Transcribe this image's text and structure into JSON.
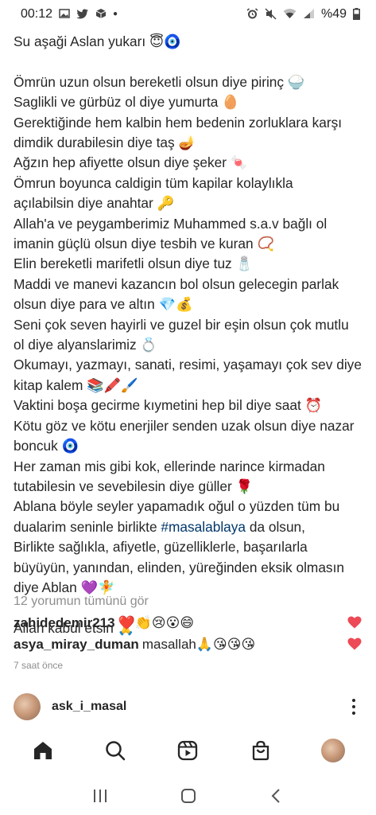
{
  "status_bar": {
    "time": "00:12",
    "battery": "%49",
    "left_icons": [
      "gallery-icon",
      "twitter-icon",
      "box-icon",
      "dot-icon"
    ],
    "right_icons": [
      "alarm-icon",
      "mute-icon",
      "wifi-icon",
      "signal-icon"
    ]
  },
  "caption": {
    "lines": [
      "Su aşaği Aslan yukarı 😇🧿",
      "",
      "Ömrün uzun olsun bereketli olsun diye pirinç 🍚",
      "Saglikli ve gürbüz ol diye yumurta 🥚",
      "Gerektiğinde hem kalbin hem bedenin zorluklara karşı",
      "dimdik durabilesin diye taş 🪔",
      "Ağzın hep afiyette olsun diye şeker 🍬",
      "Ömrun boyunca caldigin tüm kapilar kolaylıkla",
      "açılabilsin diye anahtar 🔑",
      "Allah'a ve peygamberimiz Muhammed s.a.v bağlı ol",
      "imanin güçlü olsun diye tesbih ve kuran 📿",
      "Elin bereketli marifetli olsun diye tuz 🧂",
      "Maddi ve manevi kazancın bol olsun gelecegin parlak",
      "olsun diye para ve altın 💎💰",
      "Seni çok seven hayirli ve guzel bir eşin olsun çok mutlu",
      "ol diye alyanslarimiz 💍",
      "Okumayı, yazmayı, sanati, resimi, yaşamayı çok sev diye",
      "kitap kalem 📚🖍️🖌️",
      "Vaktini boşa gecirme kıymetini hep bil diye saat ⏰",
      "Kötu göz ve kötu enerjiler senden uzak olsun diye nazar",
      "boncuk 🧿",
      "Her zaman mis gibi kok, ellerinde narince kirmadan",
      "tutabilesin ve sevebilesin diye güller 🌹",
      "Ablana böyle seyler yapamadık oğul o yüzden tüm bu",
      "dualarim seninle birlikte #masalablaya da olsun,",
      "Birlikte sağlıkla, afiyetle, güzelliklerle, başarılarla",
      "büyüyün, yanından, elinden, yüreğinden eksik olmasın",
      "diye Ablan 💜🧚",
      "",
      "Allah kabul etsin 🙏"
    ],
    "hashtag": "#masalablaya"
  },
  "view_all_comments": "12 yorumun tümünü gör",
  "comments": [
    {
      "user": "zahidedemir213",
      "text": "❤️👏😢😮😄"
    },
    {
      "user": "asya_miray_duman",
      "text": "masallah🙏😘😘😘"
    }
  ],
  "time_ago": "7 saat önce",
  "comment_input": {
    "account": "ask_i_masal"
  },
  "tabs": [
    "home-icon",
    "search-icon",
    "reels-icon",
    "shop-icon",
    "profile-avatar"
  ],
  "nav": [
    "recents-icon",
    "home-nav-icon",
    "back-icon"
  ],
  "colors": {
    "heart": "#ed4956",
    "hashtag": "#00376b",
    "muted": "#8e8e8e",
    "text": "#262626"
  }
}
